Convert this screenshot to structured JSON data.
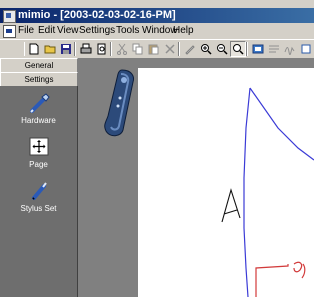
{
  "window": {
    "title": "mimio - [2003-02-03-02-16-PM]"
  },
  "menu": {
    "items": [
      "File",
      "Edit",
      "View",
      "Settings",
      "Tools",
      "Window",
      "Help"
    ]
  },
  "toolbar": {
    "buttons": [
      {
        "name": "new",
        "icon": "new-document-icon"
      },
      {
        "name": "open",
        "icon": "open-folder-icon"
      },
      {
        "name": "save",
        "icon": "save-disk-icon"
      },
      {
        "name": "print",
        "icon": "printer-icon"
      },
      {
        "name": "print-preview",
        "icon": "print-preview-icon"
      },
      {
        "name": "cut",
        "icon": "scissors-icon"
      },
      {
        "name": "copy",
        "icon": "copy-icon"
      },
      {
        "name": "paste",
        "icon": "paste-icon"
      },
      {
        "name": "delete",
        "icon": "delete-x-icon"
      },
      {
        "name": "pen",
        "icon": "pen-icon"
      },
      {
        "name": "zoom-in",
        "icon": "zoom-in-icon"
      },
      {
        "name": "zoom-out",
        "icon": "zoom-out-icon"
      },
      {
        "name": "zoom-fit",
        "icon": "zoom-fit-icon"
      },
      {
        "name": "view-pages",
        "icon": "page-view-icon"
      },
      {
        "name": "text-recognition",
        "icon": "text-recognition-icon"
      },
      {
        "name": "more",
        "icon": "toolbar-more-icon"
      }
    ]
  },
  "sidebar": {
    "tabs": [
      {
        "label": "General"
      },
      {
        "label": "Settings"
      }
    ],
    "active_tab": "Settings",
    "items": [
      {
        "label": "Hardware",
        "icon": "stylus-hardware-icon"
      },
      {
        "label": "Page",
        "icon": "page-move-icon"
      },
      {
        "label": "Stylus Set",
        "icon": "stylus-pen-icon"
      }
    ]
  },
  "canvas": {
    "handwritten_letter": "A",
    "colors": {
      "blue_stroke": "#3b3bd6",
      "red_stroke": "#d23a3a",
      "black_stroke": "#111111"
    }
  }
}
